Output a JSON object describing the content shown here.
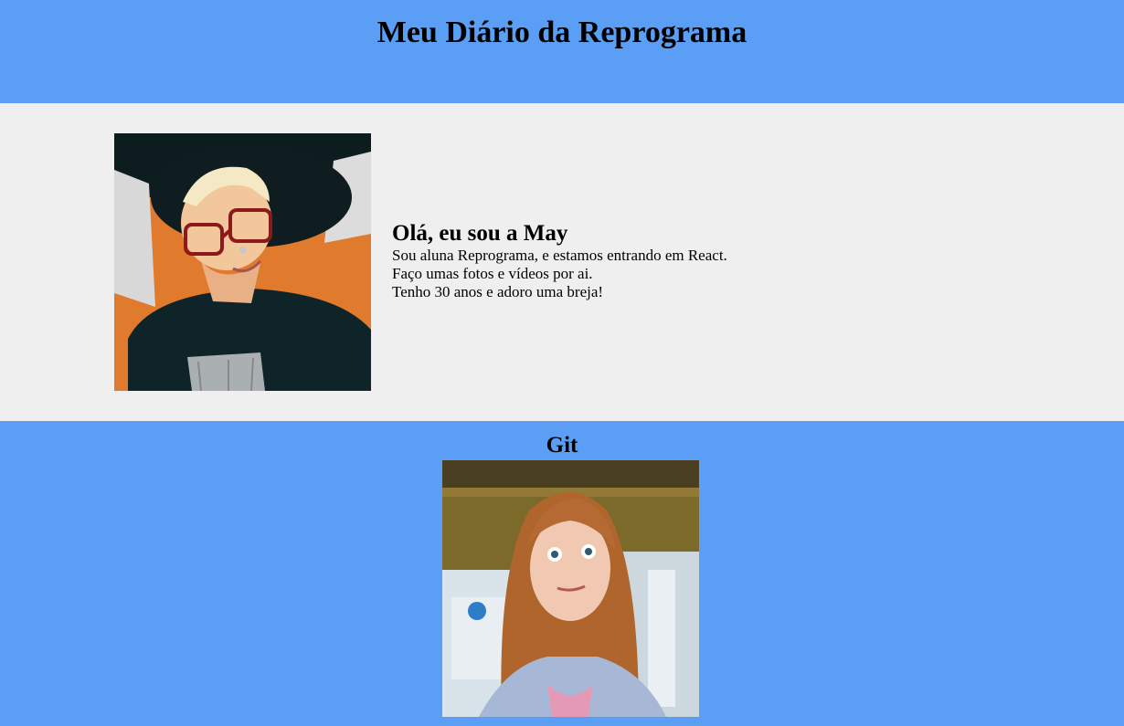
{
  "header": {
    "title": "Meu Diário da Reprograma"
  },
  "profile": {
    "heading": "Olá, eu sou a May",
    "lines": [
      "Sou aluna Reprograma, e estamos entrando em React.",
      "Faço umas fotos e vídeos por ai.",
      "Tenho 30 anos e adoro uma breja!"
    ]
  },
  "git": {
    "heading": "Git"
  },
  "colors": {
    "page_background": "#5a9ff5",
    "section_background": "#efefef"
  }
}
